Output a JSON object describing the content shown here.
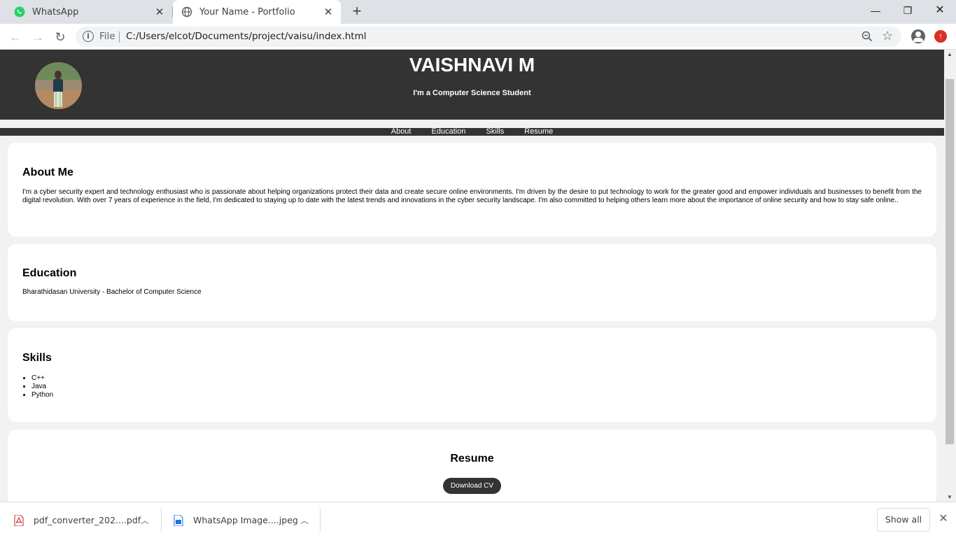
{
  "browser": {
    "tabs": [
      {
        "title": "WhatsApp",
        "icon": "whatsapp-icon",
        "active": false
      },
      {
        "title": "Your Name - Portfolio",
        "icon": "globe-icon",
        "active": true
      }
    ],
    "url_scheme_label": "File",
    "url": "C:/Users/elcot/Documents/project/vaisu/index.html"
  },
  "site": {
    "name": "VAISHNAVI M",
    "tagline": "I'm a Computer Science Student",
    "nav": [
      "About",
      "Education",
      "Skills",
      "Resume"
    ],
    "about": {
      "heading": "About Me",
      "text": "I'm a cyber security expert and technology enthusiast who is passionate about helping organizations protect their data and create secure online environments. I'm driven by the desire to put technology to work for the greater good and empower individuals and businesses to benefit from the digital revolution. With over 7 years of experience in the field, I'm dedicated to staying up to date with the latest trends and innovations in the cyber security landscape. I'm also committed to helping others learn more about the importance of online security and how to stay safe online.."
    },
    "education": {
      "heading": "Education",
      "text": "Bharathidasan University - Bachelor of Computer Science"
    },
    "skills": {
      "heading": "Skills",
      "items": [
        "C++",
        "Java",
        "Python"
      ]
    },
    "resume": {
      "heading": "Resume",
      "button": "Download CV"
    }
  },
  "downloads": {
    "items": [
      {
        "name": "pdf_converter_202....pdf",
        "icon": "pdf-file-icon"
      },
      {
        "name": "WhatsApp Image....jpeg",
        "icon": "image-file-icon"
      }
    ],
    "show_all": "Show all"
  },
  "colors": {
    "header_bg": "#333333",
    "page_bg": "#f2f2f2",
    "card_bg": "#ffffff"
  }
}
